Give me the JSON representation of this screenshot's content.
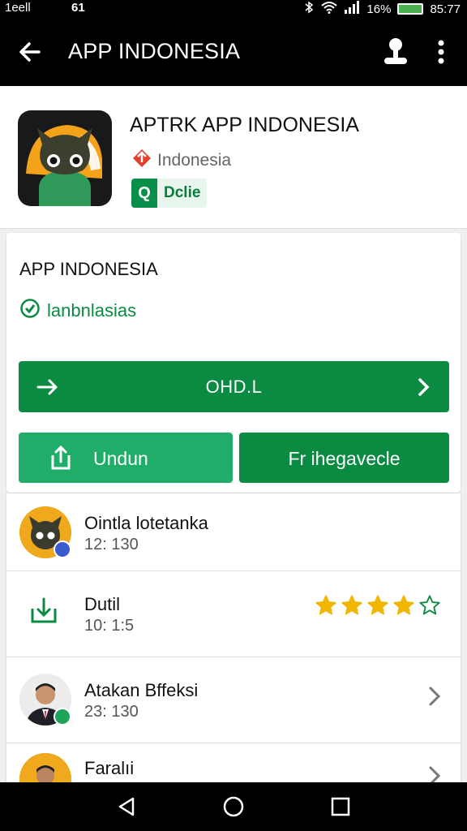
{
  "status": {
    "carrier": "1eell",
    "sim": "61",
    "battery": "16%",
    "time": "85:77"
  },
  "appbar": {
    "title": "APP INDONESIA"
  },
  "app": {
    "name": "APTRK APP INDONESIA",
    "developer": "Indonesia",
    "badge_icon": "Q",
    "badge_text": "Dclie"
  },
  "card": {
    "title": "APP INDONESIA",
    "verified": "lanbnlasias",
    "primary_button": "OHD.L",
    "secondary_buttons": [
      "Undun",
      "Fr ihegavecle"
    ]
  },
  "list": [
    {
      "title": "Ointla lotetanka",
      "sub": "12: 130"
    },
    {
      "title": "Dutil",
      "sub": "10: 1:5",
      "rating": 4,
      "rating_max": 5
    },
    {
      "title": "Atakan Bffeksi",
      "sub": "23: 130"
    },
    {
      "title": "Faralıi",
      "sub": ""
    }
  ],
  "colors": {
    "primary": "#0b8a42",
    "secondary": "#20ad6a",
    "star": "#f2b600"
  }
}
